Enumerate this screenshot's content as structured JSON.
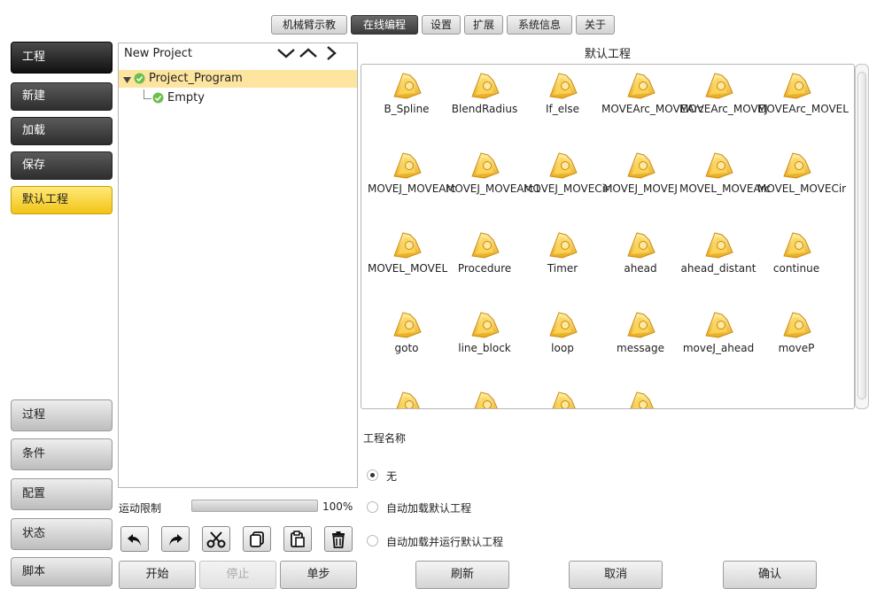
{
  "top_tabs": [
    {
      "label": "机械臂示教",
      "active": false
    },
    {
      "label": "在线编程",
      "active": true
    },
    {
      "label": "设置",
      "active": false
    },
    {
      "label": "扩展",
      "active": false
    },
    {
      "label": "系统信息",
      "active": false
    },
    {
      "label": "关于",
      "active": false
    }
  ],
  "left_nav": {
    "header": "工程",
    "items": [
      "新建",
      "加载",
      "保存",
      "默认工程"
    ],
    "bottom_items": [
      "过程",
      "条件",
      "配置",
      "状态",
      "脚本"
    ]
  },
  "tree": {
    "title": "New Project",
    "root": "Project_Program",
    "child": "Empty"
  },
  "motion_limit": {
    "label": "运动限制",
    "value": "100%",
    "fraction": 1.0
  },
  "edit_tools": [
    "undo-icon",
    "redo-icon",
    "cut-icon",
    "copy-icon",
    "paste-icon",
    "delete-icon"
  ],
  "run_buttons": {
    "start": "开始",
    "stop": "停止",
    "step": "单步"
  },
  "default_projects": {
    "title": "默认工程",
    "items": [
      "B_Spline",
      "BlendRadius",
      "If_else",
      "MOVEArc_MOVEArc",
      "MOVEArc_MOVEJ",
      "MOVEArc_MOVEL",
      "MOVEJ_MOVEArc",
      "MOVEJ_MOVEArc1",
      "MOVEJ_MOVECir",
      "MOVEJ_MOVEJ",
      "MOVEL_MOVEArc",
      "MOVEL_MOVECir",
      "MOVEL_MOVEL",
      "Procedure",
      "Timer",
      "ahead",
      "ahead_distant",
      "continue",
      "goto",
      "line_block",
      "loop",
      "message",
      "moveJ_ahead",
      "moveP",
      "",
      "",
      "",
      ""
    ]
  },
  "project_name": {
    "label": "工程名称",
    "options": [
      "无",
      "自动加载默认工程",
      "自动加载并运行默认工程"
    ],
    "selected": 0
  },
  "dialog_buttons": {
    "refresh": "刷新",
    "cancel": "取消",
    "confirm": "确认"
  },
  "colors": {
    "accent_yellow": "#f2c417",
    "selected_row": "#fde5a0",
    "dark_button": "#3a3a3a"
  }
}
